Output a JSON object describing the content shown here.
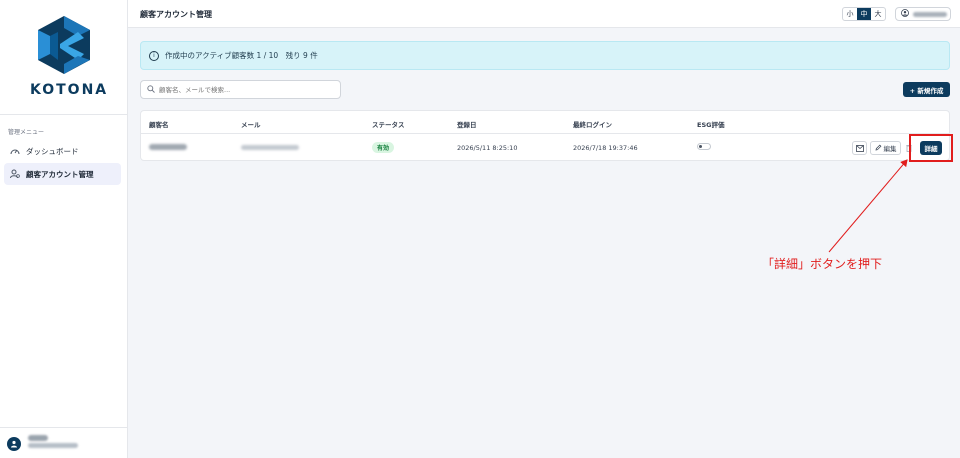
{
  "sidebar": {
    "logo_text": "KOTONA",
    "menu_label": "管理メニュー",
    "items": [
      {
        "label": "ダッシュボード",
        "icon": "gauge-icon",
        "active": false
      },
      {
        "label": "顧客アカウント管理",
        "icon": "users-icon",
        "active": true
      }
    ]
  },
  "header": {
    "title": "顧客アカウント管理",
    "font_sizes": [
      "小",
      "中",
      "大"
    ],
    "font_size_selected": "中"
  },
  "alert": {
    "text": "作成中のアクティブ顧客数 1 / 10　残り 9 件"
  },
  "search": {
    "placeholder": "顧客名、メールで検索..."
  },
  "new_button": {
    "label": "+ 新規作成"
  },
  "table": {
    "columns": [
      "顧客名",
      "メール",
      "ステータス",
      "登録日",
      "最終ログイン",
      "ESG評価"
    ],
    "rows": [
      {
        "status": "有効",
        "registered": "2026/5/11 8:25:10",
        "last_login": "2026/7/18 19:37:46",
        "edit_label": "編集",
        "detail_label": "詳細"
      }
    ]
  },
  "annotation": {
    "text": "「詳細」ボタンを押下",
    "color": "#e11d1d"
  },
  "colors": {
    "brand": "#0c3b5e",
    "alert_bg": "#d7f3f9",
    "status_green": "#15803d"
  }
}
